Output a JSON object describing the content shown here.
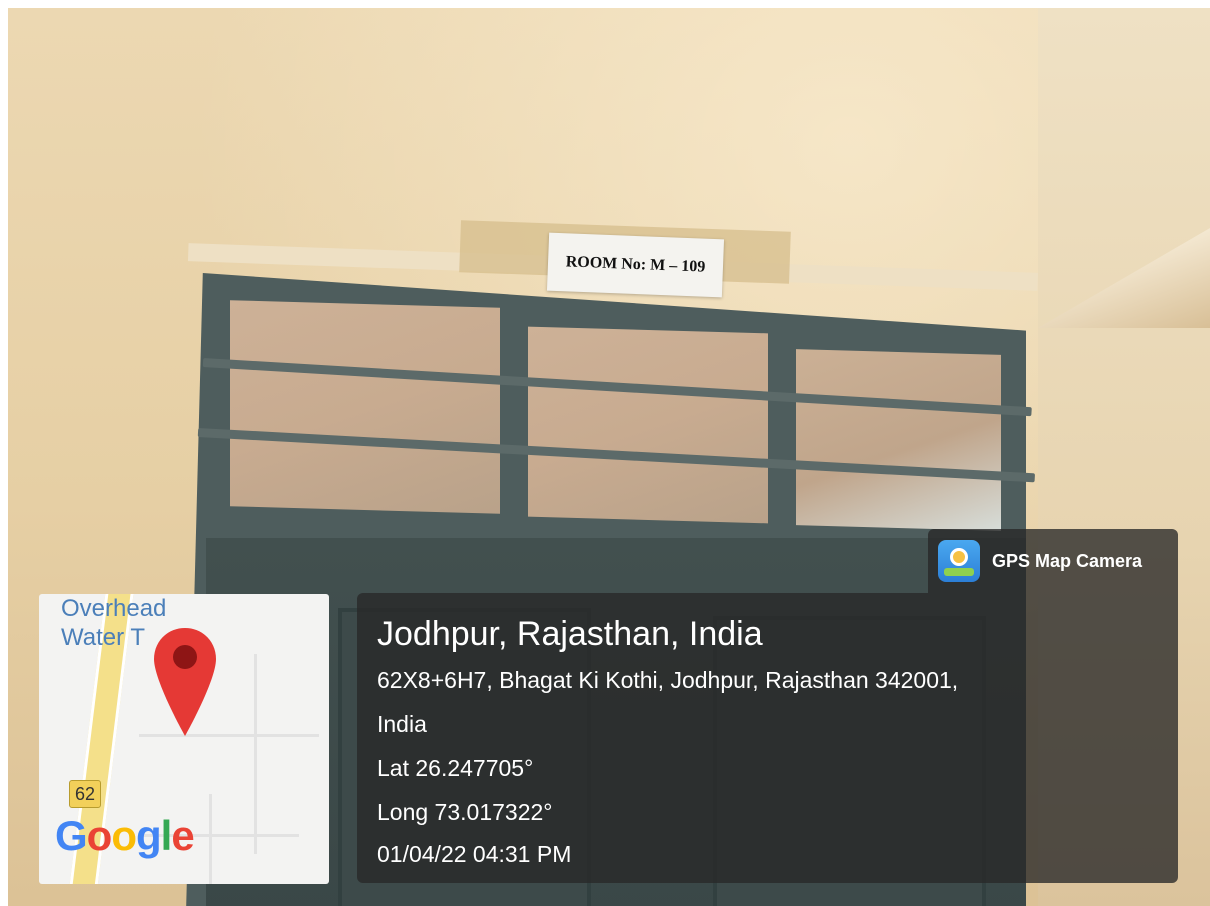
{
  "sign": {
    "text": "ROOM No: M – 109"
  },
  "map": {
    "label": "Overhead\nWater T",
    "route_number": "62",
    "logo": {
      "letters": [
        "G",
        "o",
        "o",
        "g",
        "l",
        "e"
      ]
    }
  },
  "gps_badge": {
    "label": "GPS Map Camera",
    "icon": "gps-map-camera-icon"
  },
  "location": {
    "title": "Jodhpur, Rajasthan, India",
    "address_line1": "62X8+6H7, Bhagat Ki Kothi, Jodhpur, Rajasthan 342001,",
    "address_line2": "India",
    "latitude": "Lat 26.247705°",
    "longitude": "Long 73.017322°",
    "datetime": "01/04/22 04:31 PM"
  },
  "colors": {
    "pin_red": "#e53935",
    "overlay": "#282828",
    "google_blue": "#4285f4",
    "google_red": "#ea4335",
    "google_yellow": "#fbbc05",
    "google_green": "#34a853"
  }
}
